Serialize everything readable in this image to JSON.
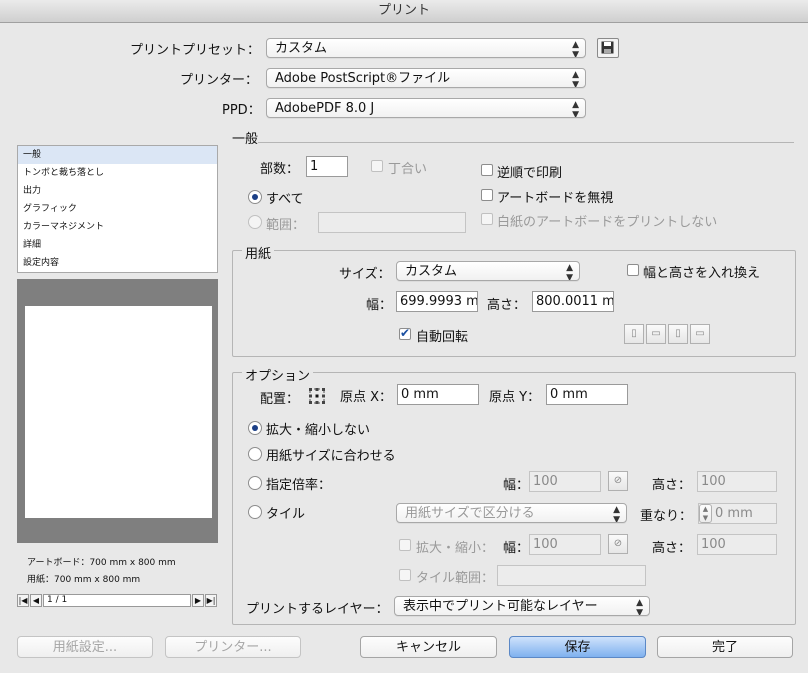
{
  "window": {
    "title": "プリント"
  },
  "header": {
    "preset_label": "プリントプリセット：",
    "preset_value": "カスタム",
    "printer_label": "プリンター：",
    "printer_value": "Adobe PostScript®ファイル",
    "ppd_label": "PPD：",
    "ppd_value": "AdobePDF 8.0 J"
  },
  "sidebar": {
    "items": [
      "一般",
      "トンボと裁ち落とし",
      "出力",
      "グラフィック",
      "カラーマネジメント",
      "詳細",
      "設定内容"
    ],
    "artboard_info": "アートボード：700 mm x 800 mm",
    "paper_info": "用紙：700 mm x 800 mm",
    "page_nav": "1 / 1"
  },
  "general": {
    "section_title": "一般",
    "copies_label": "部数：",
    "copies_value": "1",
    "collate_label": "丁合い",
    "reverse_label": "逆順で印刷",
    "ignore_artboards_label": "アートボードを無視",
    "skip_blank_label": "白紙のアートボードをプリントしない",
    "all_label": "すべて",
    "range_label": "範囲："
  },
  "media": {
    "section_title": "用紙",
    "size_label": "サイズ：",
    "size_value": "カスタム",
    "swap_label": "幅と高さを入れ換え",
    "width_label": "幅：",
    "width_value": "699.9993 m",
    "height_label": "高さ：",
    "height_value": "800.0011 m",
    "auto_rotate_label": "自動回転"
  },
  "options": {
    "section_title": "オプション",
    "placement_label": "配置：",
    "origin_x_label": "原点 X：",
    "origin_x_value": "0 mm",
    "origin_y_label": "原点 Y：",
    "origin_y_value": "0 mm",
    "no_scale_label": "拡大・縮小しない",
    "fit_label": "用紙サイズに合わせる",
    "custom_scale_label": "指定倍率：",
    "width_label": "幅：",
    "width_value": "100",
    "height_label": "高さ：",
    "height_value": "100",
    "tile_label": "タイル",
    "tile_mode_value": "用紙サイズで区分ける",
    "overlap_label": "重なり：",
    "overlap_value": "0 mm",
    "tile_scale_label": "拡大・縮小：",
    "tile_width_label": "幅：",
    "tile_width_value": "100",
    "tile_height_label": "高さ：",
    "tile_height_value": "100",
    "tile_range_label": "タイル範囲：",
    "layers_label": "プリントするレイヤー：",
    "layers_value": "表示中でプリント可能なレイヤー"
  },
  "footer": {
    "page_setup": "用紙設定...",
    "printer": "プリンター...",
    "cancel": "キャンセル",
    "save": "保存",
    "done": "完了"
  },
  "colors": {
    "default_button": "#7fb1ef",
    "selected_item": "#dbe6f5"
  }
}
